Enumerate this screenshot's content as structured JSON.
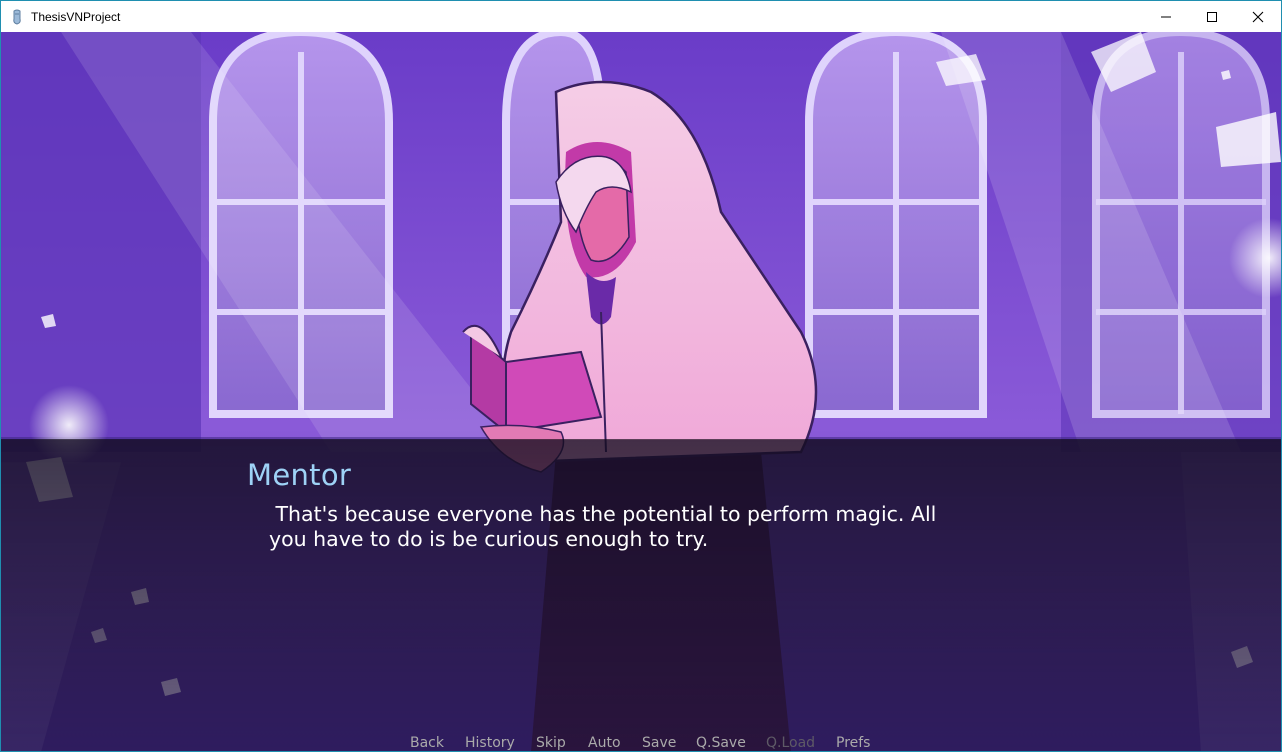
{
  "window": {
    "title": "ThesisVNProject",
    "controls": [
      "minimize",
      "maximize",
      "close"
    ]
  },
  "game": {
    "scene": "purple library hall with arched windows and floating pages; hooded mentor holding an open book",
    "speaker": "Mentor",
    "speaker_color": "#9ed2f6",
    "dialogue": " That's because everyone has the potential to perform magic. All\nyou have to do is be curious enough to try."
  },
  "quick_menu": {
    "items": [
      {
        "label": "Back",
        "enabled": true
      },
      {
        "label": "History",
        "enabled": true
      },
      {
        "label": "Skip",
        "enabled": true
      },
      {
        "label": "Auto",
        "enabled": true
      },
      {
        "label": "Save",
        "enabled": true
      },
      {
        "label": "Q.Save",
        "enabled": true
      },
      {
        "label": "Q.Load",
        "enabled": false
      },
      {
        "label": "Prefs",
        "enabled": true
      }
    ]
  },
  "colors": {
    "titlebar_border": "#1f8fb0",
    "menu_text": "#aaaaaa",
    "menu_disabled": "#5e5a66",
    "dialogue_text": "#ffffff"
  }
}
